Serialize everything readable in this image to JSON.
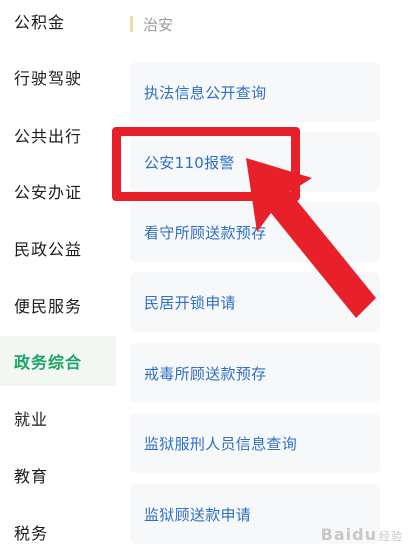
{
  "sidebar": {
    "items": [
      {
        "label": "公积金"
      },
      {
        "label": "行驶驾驶"
      },
      {
        "label": "公共出行"
      },
      {
        "label": "公安办证"
      },
      {
        "label": "民政公益"
      },
      {
        "label": "便民服务"
      },
      {
        "label": "政务综合",
        "active": true
      },
      {
        "label": "就业"
      },
      {
        "label": "教育"
      },
      {
        "label": "税务"
      }
    ]
  },
  "main": {
    "section_title": "治安",
    "cards": [
      {
        "label": "执法信息公开查询"
      },
      {
        "label": "公安110报警"
      },
      {
        "label": "看守所顾送款预存"
      },
      {
        "label": "民居开锁申请"
      },
      {
        "label": "戒毒所顾送款预存"
      },
      {
        "label": "监狱服刑人员信息查询"
      },
      {
        "label": "监狱顾送款申请"
      }
    ]
  },
  "annotation": {
    "color": "#e8202a"
  },
  "watermark": {
    "brand": "Baidu",
    "suffix": "经验"
  },
  "colors": {
    "active_text": "#1aa564",
    "card_text": "#2e6fc8",
    "section_bar": "#f3d9b0"
  }
}
